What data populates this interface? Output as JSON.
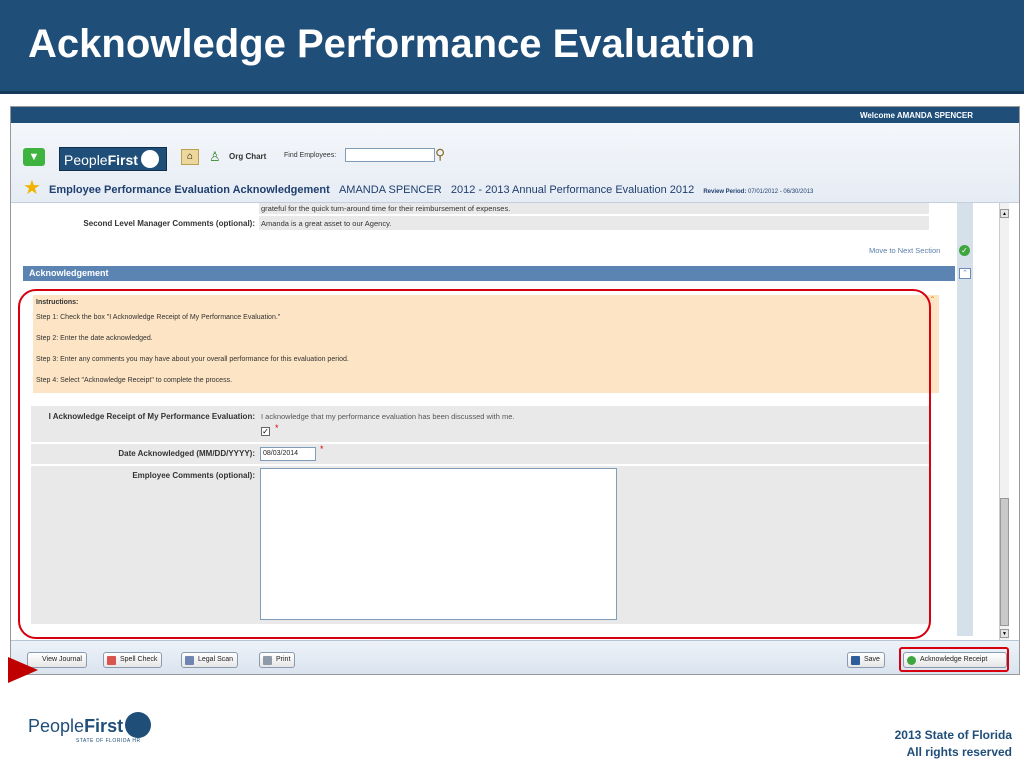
{
  "slide": {
    "title": "Acknowledge Performance Evaluation",
    "copyright_line1": "2013 State of Florida",
    "copyright_line2": "All rights reserved",
    "footer_logo_text": "People",
    "footer_logo_bold": "First",
    "footer_logo_sub": "STATE OF FLORIDA HR"
  },
  "app": {
    "welcome": "Welcome AMANDA SPENCER",
    "logo_text": "People",
    "logo_bold": "First",
    "org_chart": "Org Chart",
    "find_employees_label": "Find Employees:",
    "find_employees_value": "",
    "page_title": "Employee Performance Evaluation Acknowledgement",
    "employee_name": "AMANDA SPENCER",
    "evaluation_name": "2012 - 2013 Annual Performance Evaluation 2012",
    "review_period_label": "Review Period:",
    "review_period_value": "07/01/2012 - 06/30/2013"
  },
  "form": {
    "prev_comment_text": "grateful for the quick turn-around time for their reimbursement of expenses.",
    "second_level_label": "Second Level Manager Comments (optional):",
    "second_level_value": "Amanda is a great asset to our Agency.",
    "move_next": "Move to Next Section",
    "section_title": "Acknowledgement",
    "instructions": {
      "heading": "Instructions:",
      "step1": "Step 1: Check the box \"I Acknowledge Receipt of My Performance Evaluation.\"",
      "step2": "Step 2: Enter the date acknowledged.",
      "step3": "Step 3: Enter any comments you may have about your overall performance for this evaluation period.",
      "step4": "Step 4: Select \"Acknowledge Receipt\" to complete the process."
    },
    "ack_label": "I Acknowledge Receipt of My Performance Evaluation:",
    "ack_text": "I acknowledge that my performance evaluation has been discussed with me.",
    "ack_checked": true,
    "date_label": "Date Acknowledged (MM/DD/YYYY):",
    "date_value": "08/03/2014",
    "comments_label": "Employee Comments (optional):",
    "comments_value": "",
    "required_mark": "*"
  },
  "buttons": {
    "view_journal": "View Journal",
    "spell_check": "Spell Check",
    "legal_scan": "Legal Scan",
    "print": "Print",
    "save": "Save",
    "acknowledge": "Acknowledge Receipt"
  },
  "colors": {
    "header_blue": "#1f4e79",
    "section_blue": "#5b84b3",
    "instructions_bg": "#fce4c4",
    "highlight_red": "#d6000e"
  }
}
